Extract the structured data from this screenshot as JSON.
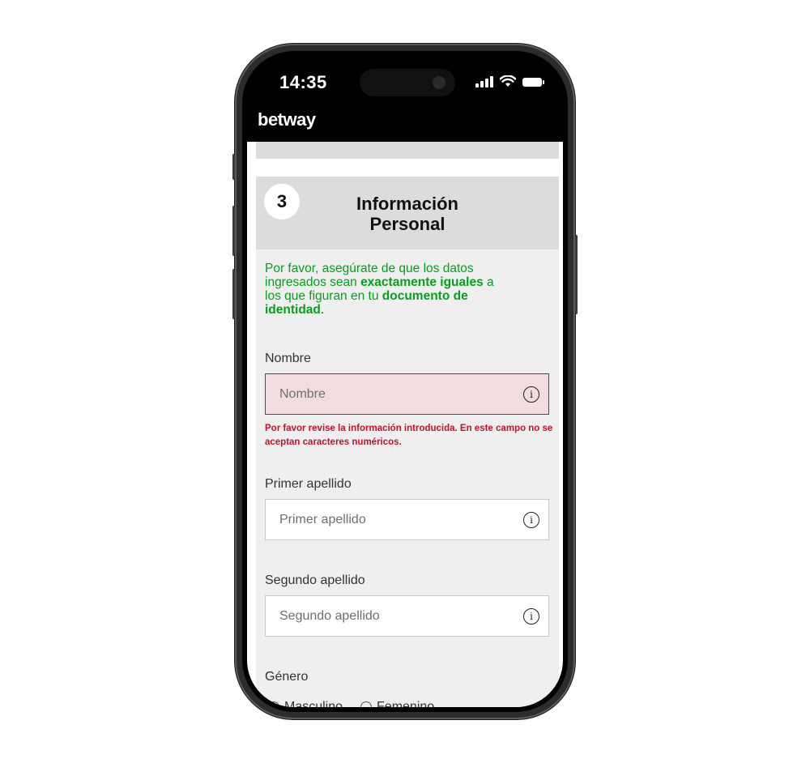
{
  "status_bar": {
    "time": "14:35"
  },
  "app": {
    "brand": "betway"
  },
  "step": {
    "number": "3",
    "title_line1": "Información",
    "title_line2": "Personal"
  },
  "notice": {
    "part1": "Por favor, asegúrate de que los datos ingresados sean ",
    "bold1": "exactamente iguales",
    "part2": " a los que figuran en tu ",
    "bold2": "documento de identidad",
    "part3": "."
  },
  "fields": {
    "nombre": {
      "label": "Nombre",
      "placeholder": "Nombre",
      "error": "Por favor revise la información introducida. En este campo no se aceptan caracteres numéricos."
    },
    "primer_apellido": {
      "label": "Primer apellido",
      "placeholder": "Primer apellido"
    },
    "segundo_apellido": {
      "label": "Segundo apellido",
      "placeholder": "Segundo apellido"
    }
  },
  "genero": {
    "label": "Género",
    "options": [
      "Masculino",
      "Femenino"
    ]
  },
  "icons": {
    "info": "i"
  },
  "colors": {
    "accent_green": "#06a01c",
    "error_red": "#c8102e",
    "error_bg": "#f2dcdf"
  }
}
